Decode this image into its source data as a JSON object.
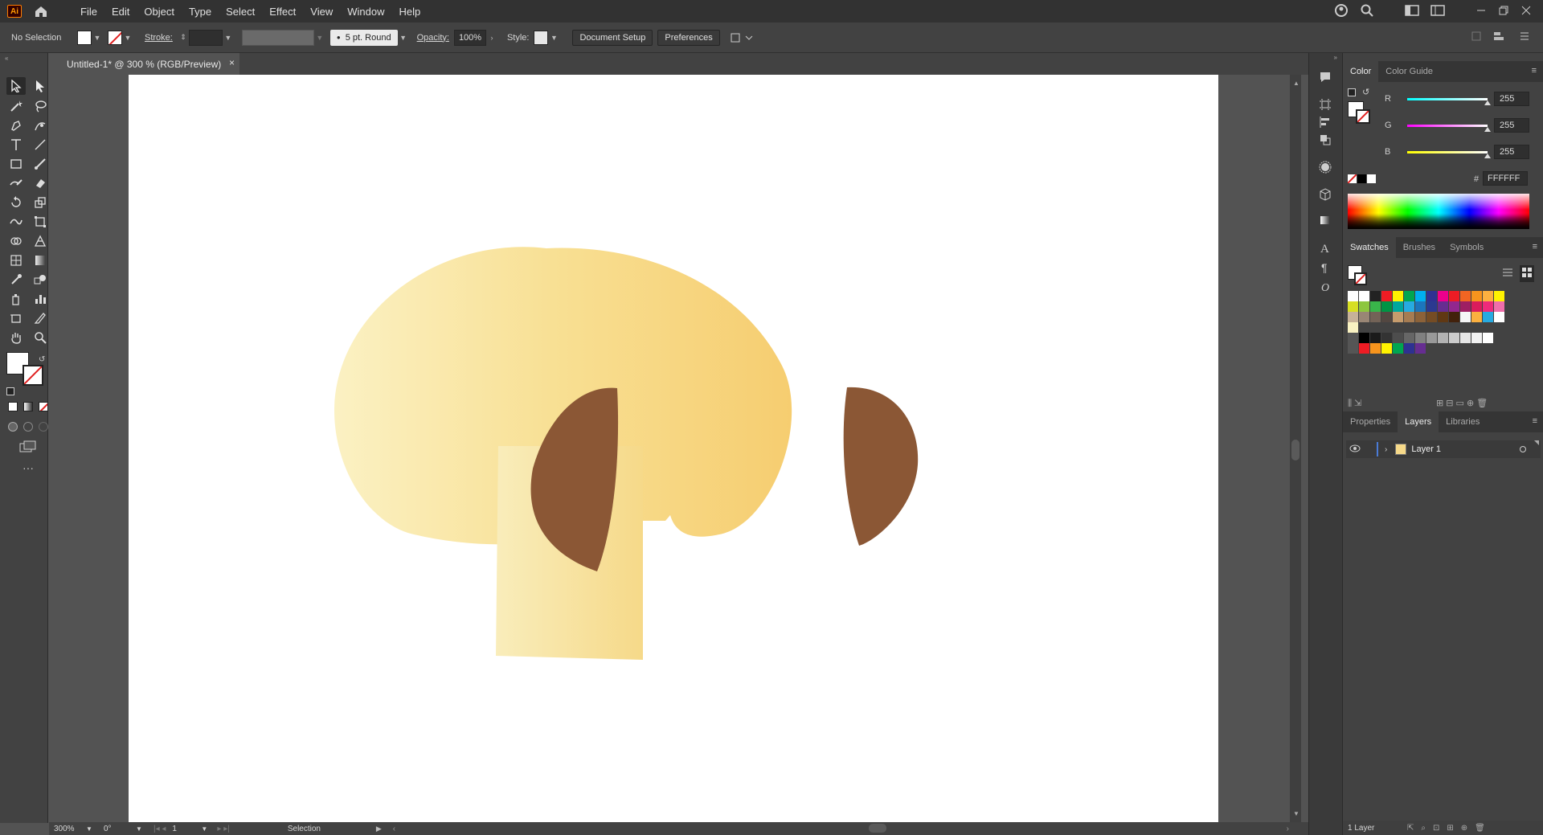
{
  "app": {
    "logo": "Ai"
  },
  "menu": [
    "File",
    "Edit",
    "Object",
    "Type",
    "Select",
    "Effect",
    "View",
    "Window",
    "Help"
  ],
  "control_bar": {
    "selection": "No Selection",
    "stroke_label": "Stroke:",
    "brush": "5 pt. Round",
    "opacity_label": "Opacity:",
    "opacity_value": "100%",
    "style_label": "Style:",
    "document_setup": "Document Setup",
    "preferences": "Preferences"
  },
  "document": {
    "tab_title": "Untitled-1* @ 300 % (RGB/Preview)",
    "close": "×"
  },
  "status": {
    "zoom": "300%",
    "rotation": "0°",
    "artboard": "1",
    "tool": "Selection"
  },
  "color_panel": {
    "tabs": [
      "Color",
      "Color Guide"
    ],
    "r_label": "R",
    "r": "255",
    "g_label": "G",
    "g": "255",
    "b_label": "B",
    "b": "255",
    "hex_label": "#",
    "hex": "FFFFFF"
  },
  "swatches_panel": {
    "tabs": [
      "Swatches",
      "Brushes",
      "Symbols"
    ]
  },
  "layers_panel": {
    "tabs": [
      "Properties",
      "Layers",
      "Libraries"
    ],
    "layer_name": "Layer 1",
    "count": "1 Layer"
  },
  "artwork": {
    "cap_gradient": [
      "#fbf1c3",
      "#f8df92",
      "#f6cd70"
    ],
    "gill_color": "#8b5735",
    "stem_gradient": [
      "#f9edbb",
      "#f6d989"
    ]
  },
  "colors": {
    "swatches_row1": [
      "#ffffff",
      "#ffffff",
      "#222222",
      "#ee1c24",
      "#fff200",
      "#00a651",
      "#00aeef",
      "#2e3192",
      "#ec008c",
      "#ed1c24",
      "#f26522",
      "#f7941d",
      "#fbb040",
      "#fff200"
    ],
    "swatches_row2": [
      "#d7df23",
      "#8dc63f",
      "#39b54a",
      "#009444",
      "#00a79d",
      "#27aae1",
      "#1c75bc",
      "#2b3990",
      "#662d91",
      "#92278f",
      "#9e1f63",
      "#da1c5c",
      "#ee2a7b",
      "#f06eaa"
    ],
    "swatches_row3": [
      "#c7b299",
      "#998675",
      "#736357",
      "#534741",
      "#c69c6d",
      "#a67c52",
      "#8c6239",
      "#754c24",
      "#603813",
      "#42210b",
      "#f5f5f5",
      "#fbb040",
      "#27aae1",
      "#ffffff"
    ],
    "grays": [
      "#000000",
      "#1a1a1a",
      "#333333",
      "#4d4d4d",
      "#666666",
      "#808080",
      "#999999",
      "#b3b3b3",
      "#cccccc",
      "#e6e6e6",
      "#f2f2f2",
      "#ffffff"
    ],
    "brights": [
      "#ee1c24",
      "#f7941d",
      "#fff200",
      "#00a651",
      "#2e3192",
      "#662d91"
    ]
  }
}
